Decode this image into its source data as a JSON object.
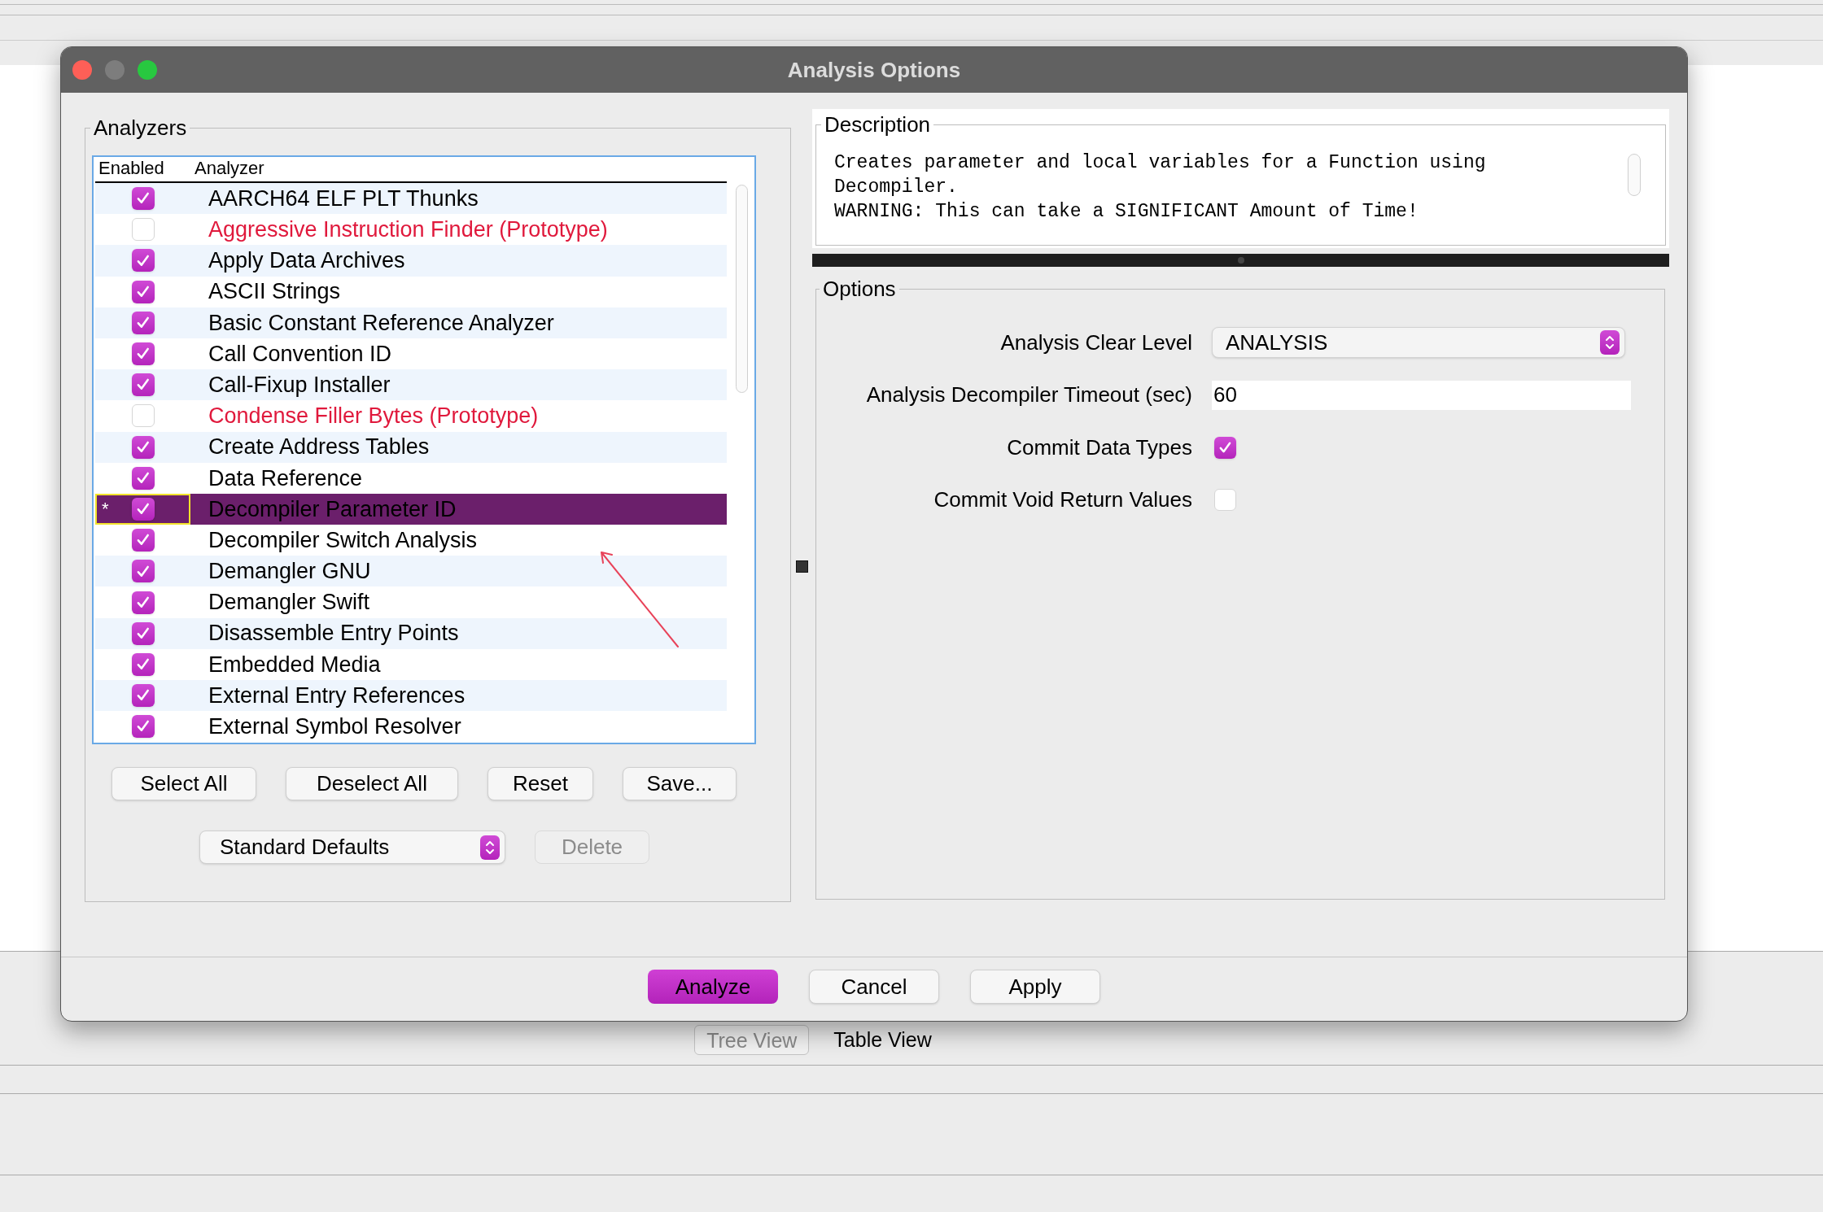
{
  "window": {
    "title": "Analysis Options"
  },
  "analyzers": {
    "title": "Analyzers",
    "columns": [
      "Enabled",
      "Analyzer"
    ],
    "rows": [
      {
        "name": "AARCH64 ELF PLT Thunks",
        "enabled": true,
        "prototype": false,
        "selected": false
      },
      {
        "name": "Aggressive Instruction Finder (Prototype)",
        "enabled": false,
        "prototype": true,
        "selected": false
      },
      {
        "name": "Apply Data Archives",
        "enabled": true,
        "prototype": false,
        "selected": false
      },
      {
        "name": "ASCII Strings",
        "enabled": true,
        "prototype": false,
        "selected": false
      },
      {
        "name": "Basic Constant Reference Analyzer",
        "enabled": true,
        "prototype": false,
        "selected": false
      },
      {
        "name": "Call Convention ID",
        "enabled": true,
        "prototype": false,
        "selected": false
      },
      {
        "name": "Call-Fixup Installer",
        "enabled": true,
        "prototype": false,
        "selected": false
      },
      {
        "name": "Condense Filler Bytes (Prototype)",
        "enabled": false,
        "prototype": true,
        "selected": false
      },
      {
        "name": "Create Address Tables",
        "enabled": true,
        "prototype": false,
        "selected": false
      },
      {
        "name": "Data Reference",
        "enabled": true,
        "prototype": false,
        "selected": false
      },
      {
        "name": "Decompiler Parameter ID",
        "enabled": true,
        "prototype": false,
        "selected": true,
        "marker": "*"
      },
      {
        "name": "Decompiler Switch Analysis",
        "enabled": true,
        "prototype": false,
        "selected": false
      },
      {
        "name": "Demangler GNU",
        "enabled": true,
        "prototype": false,
        "selected": false
      },
      {
        "name": "Demangler Swift",
        "enabled": true,
        "prototype": false,
        "selected": false
      },
      {
        "name": "Disassemble Entry Points",
        "enabled": true,
        "prototype": false,
        "selected": false
      },
      {
        "name": "Embedded Media",
        "enabled": true,
        "prototype": false,
        "selected": false
      },
      {
        "name": "External Entry References",
        "enabled": true,
        "prototype": false,
        "selected": false
      },
      {
        "name": "External Symbol Resolver",
        "enabled": true,
        "prototype": false,
        "selected": false
      }
    ],
    "buttons": [
      "Select All",
      "Deselect All",
      "Reset",
      "Save..."
    ],
    "defaults": {
      "value": "Standard Defaults"
    },
    "delete": {
      "label": "Delete",
      "disabled": true
    }
  },
  "description": {
    "title": "Description",
    "lines": [
      "Creates parameter and local variables for a Function using",
      "Decompiler.",
      "WARNING: This can take a SIGNIFICANT Amount of Time!"
    ]
  },
  "options": {
    "title": "Options",
    "items": [
      {
        "kind": "select",
        "label": "Analysis Clear Level",
        "value": "ANALYSIS"
      },
      {
        "kind": "text",
        "label": "Analysis Decompiler Timeout (sec)",
        "value": "60"
      },
      {
        "kind": "checkbox",
        "label": "Commit Data Types",
        "checked": true
      },
      {
        "kind": "checkbox",
        "label": "Commit Void Return Values",
        "checked": false
      }
    ]
  },
  "footer_buttons": [
    {
      "label": "Analyze",
      "default": true
    },
    {
      "label": "Cancel",
      "default": false
    },
    {
      "label": "Apply",
      "default": false
    }
  ],
  "background": {
    "tabs": [
      {
        "label": "Tree View",
        "disabled": true
      },
      {
        "label": "Table View",
        "disabled": false
      }
    ]
  }
}
